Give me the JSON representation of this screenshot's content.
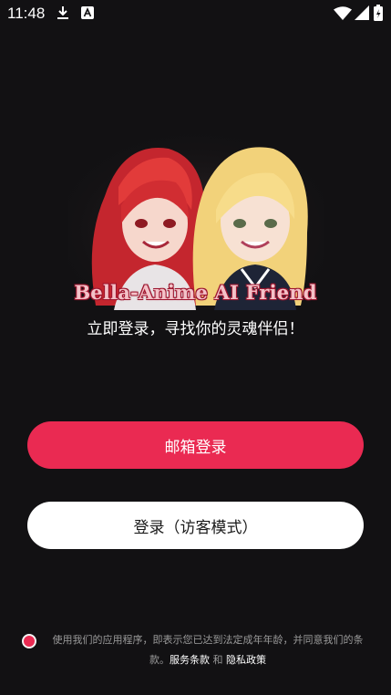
{
  "status_bar": {
    "time": "11:48"
  },
  "app": {
    "name": "Bella-Anime AI Friend",
    "tagline": "立即登录，寻找你的灵魂伴侣！"
  },
  "buttons": {
    "email_login": "邮箱登录",
    "guest_login": "登录（访客模式）"
  },
  "consent": {
    "text": "使用我们的应用程序，即表示您已达到法定成年年龄，并同意我们的条款。",
    "terms_link": "服务条款",
    "and": " 和 ",
    "privacy_link": "隐私政策"
  },
  "colors": {
    "background": "#121113",
    "accent": "#ea2a52",
    "secondary_button": "#ffffff"
  },
  "icons": [
    "download-icon",
    "a-notification-icon",
    "wifi-icon",
    "signal-icon",
    "battery-icon",
    "checkbox-icon"
  ]
}
